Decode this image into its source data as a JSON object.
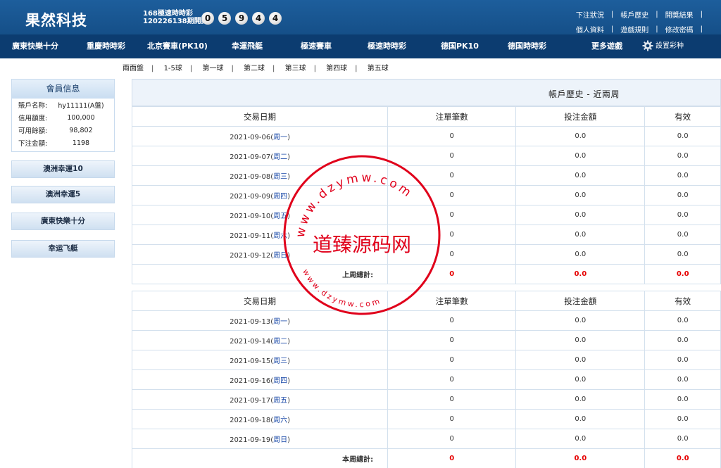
{
  "header": {
    "logo": "果然科技",
    "draw_title": "168極速時時彩",
    "draw_period": "120226138期開獎:",
    "balls": [
      "0",
      "5",
      "9",
      "4",
      "4"
    ],
    "links_row1": [
      "下注狀況",
      "帳戶歷史",
      "開獎結果"
    ],
    "links_row2": [
      "個人資料",
      "遊戲規則",
      "修改密碼"
    ]
  },
  "nav": {
    "items": [
      "廣東快樂十分",
      "重慶時時彩",
      "北京賽車(PK10)",
      "幸運飛艇",
      "極速賽車",
      "極速時時彩",
      "德国PK10",
      "德国時時彩",
      "更多遊戲"
    ],
    "settings_label": "設置彩种"
  },
  "subnav": [
    "兩面盤",
    "1-5球",
    "第一球",
    "第二球",
    "第三球",
    "第四球",
    "第五球"
  ],
  "member": {
    "title": "會員信息",
    "rows": [
      {
        "k": "賬戶名称:",
        "v": "hy11111(A盤)"
      },
      {
        "k": "信用額度:",
        "v": "100,000"
      },
      {
        "k": "可用餘額:",
        "v": "98,802"
      },
      {
        "k": "下注金額:",
        "v": "1198"
      }
    ]
  },
  "side_buttons": [
    "澳洲幸運10",
    "澳洲幸運5",
    "廣東快樂十分",
    "幸运飞艇"
  ],
  "history": {
    "title": "帳戶歷史 - 近兩周",
    "headers": [
      "交易日期",
      "注單筆數",
      "投注金額",
      "有效"
    ],
    "week1": {
      "rows": [
        {
          "date": "2021-09-06",
          "wd": "周一",
          "count": "0",
          "amount": "0.0",
          "valid": "0.0"
        },
        {
          "date": "2021-09-07",
          "wd": "周二",
          "count": "0",
          "amount": "0.0",
          "valid": "0.0"
        },
        {
          "date": "2021-09-08",
          "wd": "周三",
          "count": "0",
          "amount": "0.0",
          "valid": "0.0"
        },
        {
          "date": "2021-09-09",
          "wd": "周四",
          "count": "0",
          "amount": "0.0",
          "valid": "0.0"
        },
        {
          "date": "2021-09-10",
          "wd": "周五",
          "count": "0",
          "amount": "0.0",
          "valid": "0.0"
        },
        {
          "date": "2021-09-11",
          "wd": "周六",
          "count": "0",
          "amount": "0.0",
          "valid": "0.0"
        },
        {
          "date": "2021-09-12",
          "wd": "周日",
          "count": "0",
          "amount": "0.0",
          "valid": "0.0"
        }
      ],
      "total": {
        "label": "上周總計:",
        "count": "0",
        "amount": "0.0",
        "valid": "0.0"
      }
    },
    "week2": {
      "rows": [
        {
          "date": "2021-09-13",
          "wd": "周一",
          "count": "0",
          "amount": "0.0",
          "valid": "0.0"
        },
        {
          "date": "2021-09-14",
          "wd": "周二",
          "count": "0",
          "amount": "0.0",
          "valid": "0.0"
        },
        {
          "date": "2021-09-15",
          "wd": "周三",
          "count": "0",
          "amount": "0.0",
          "valid": "0.0"
        },
        {
          "date": "2021-09-16",
          "wd": "周四",
          "count": "0",
          "amount": "0.0",
          "valid": "0.0"
        },
        {
          "date": "2021-09-17",
          "wd": "周五",
          "count": "0",
          "amount": "0.0",
          "valid": "0.0"
        },
        {
          "date": "2021-09-18",
          "wd": "周六",
          "count": "0",
          "amount": "0.0",
          "valid": "0.0"
        },
        {
          "date": "2021-09-19",
          "wd": "周日",
          "count": "0",
          "amount": "0.0",
          "valid": "0.0"
        }
      ],
      "total": {
        "label": "本周總計:",
        "count": "0",
        "amount": "0.0",
        "valid": "0.0"
      }
    }
  },
  "watermark": {
    "center_text": "道臻源码网",
    "ring_top": "www.dzymw.com",
    "ring_bottom": "www.dzymw.com"
  }
}
